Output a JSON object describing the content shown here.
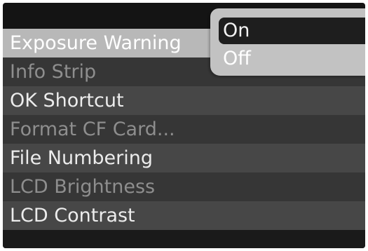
{
  "menu": {
    "items": [
      {
        "label": "Exposure Warning"
      },
      {
        "label": "Info Strip"
      },
      {
        "label": "OK Shortcut"
      },
      {
        "label": "Format CF Card..."
      },
      {
        "label": "File Numbering"
      },
      {
        "label": "LCD Brightness"
      },
      {
        "label": "LCD Contrast"
      }
    ]
  },
  "popup": {
    "options": [
      {
        "label": "On"
      },
      {
        "label": "Off"
      }
    ],
    "selected": "On"
  },
  "colors": {
    "screen_background": "#141414",
    "selected_row": "#b8b8b8",
    "popup_background": "#c2c2c2",
    "popup_highlight": "#1e1e1e"
  }
}
